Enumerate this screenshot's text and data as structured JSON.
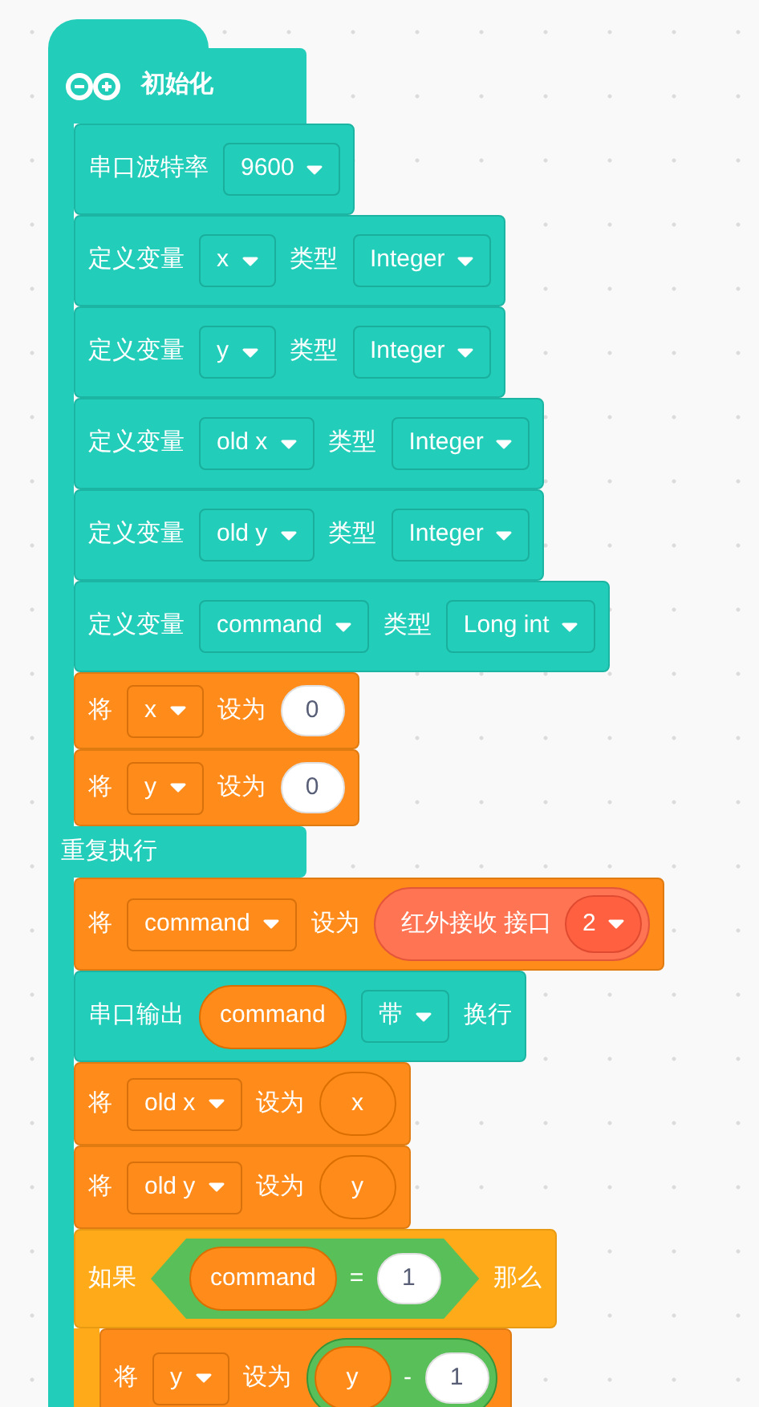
{
  "hat": {
    "label": "初始化"
  },
  "setup": [
    {
      "kind": "arduino",
      "parts": [
        {
          "kind": "text",
          "text": "串口波特率"
        },
        {
          "kind": "dropdown",
          "text": "9600"
        }
      ]
    },
    {
      "kind": "arduino",
      "parts": [
        {
          "kind": "text",
          "text": "定义变量"
        },
        {
          "kind": "dropdown",
          "text": "x"
        },
        {
          "kind": "text",
          "text": "类型"
        },
        {
          "kind": "dropdown",
          "text": "Integer"
        }
      ]
    },
    {
      "kind": "arduino",
      "parts": [
        {
          "kind": "text",
          "text": "定义变量"
        },
        {
          "kind": "dropdown",
          "text": "y"
        },
        {
          "kind": "text",
          "text": "类型"
        },
        {
          "kind": "dropdown",
          "text": "Integer"
        }
      ]
    },
    {
      "kind": "arduino",
      "parts": [
        {
          "kind": "text",
          "text": "定义变量"
        },
        {
          "kind": "dropdown",
          "text": "old x"
        },
        {
          "kind": "text",
          "text": "类型"
        },
        {
          "kind": "dropdown",
          "text": "Integer"
        }
      ]
    },
    {
      "kind": "arduino",
      "parts": [
        {
          "kind": "text",
          "text": "定义变量"
        },
        {
          "kind": "dropdown",
          "text": "old y"
        },
        {
          "kind": "text",
          "text": "类型"
        },
        {
          "kind": "dropdown",
          "text": "Integer"
        }
      ]
    },
    {
      "kind": "arduino",
      "parts": [
        {
          "kind": "text",
          "text": "定义变量"
        },
        {
          "kind": "dropdown",
          "text": "command"
        },
        {
          "kind": "text",
          "text": "类型"
        },
        {
          "kind": "dropdown",
          "text": "Long int"
        }
      ]
    },
    {
      "kind": "variable",
      "parts": [
        {
          "kind": "text",
          "text": "将"
        },
        {
          "kind": "dropdown",
          "text": "x"
        },
        {
          "kind": "text",
          "text": "设为"
        },
        {
          "kind": "number",
          "text": "0"
        }
      ]
    },
    {
      "kind": "variable",
      "parts": [
        {
          "kind": "text",
          "text": "将"
        },
        {
          "kind": "dropdown",
          "text": "y"
        },
        {
          "kind": "text",
          "text": "设为"
        },
        {
          "kind": "number",
          "text": "0"
        }
      ]
    }
  ],
  "loop": {
    "label": "重复执行",
    "blocks": [
      {
        "kind": "variable",
        "parts": [
          {
            "kind": "text",
            "text": "将"
          },
          {
            "kind": "dropdown",
            "text": "command"
          },
          {
            "kind": "text",
            "text": "设为"
          },
          {
            "kind": "sensor",
            "label": "红外接收 接口",
            "dropdown": "2"
          }
        ]
      },
      {
        "kind": "arduino",
        "parts": [
          {
            "kind": "text",
            "text": "串口输出"
          },
          {
            "kind": "variable",
            "text": "command"
          },
          {
            "kind": "dropdown",
            "text": "带"
          },
          {
            "kind": "text",
            "text": "换行"
          }
        ]
      },
      {
        "kind": "variable",
        "parts": [
          {
            "kind": "text",
            "text": "将"
          },
          {
            "kind": "dropdown",
            "text": "old x"
          },
          {
            "kind": "text",
            "text": "设为"
          },
          {
            "kind": "variable",
            "text": "x"
          }
        ]
      },
      {
        "kind": "variable",
        "parts": [
          {
            "kind": "text",
            "text": "将"
          },
          {
            "kind": "dropdown",
            "text": "old y"
          },
          {
            "kind": "text",
            "text": "设为"
          },
          {
            "kind": "variable",
            "text": "y"
          }
        ]
      },
      {
        "kind": "control",
        "parts": [
          {
            "kind": "text",
            "text": "如果"
          },
          {
            "kind": "compare",
            "left": {
              "kind": "variable",
              "text": "command"
            },
            "operator": "=",
            "right": {
              "kind": "number",
              "text": "1"
            }
          },
          {
            "kind": "text",
            "text": "那么"
          }
        ],
        "children": [
          {
            "kind": "variable",
            "parts": [
              {
                "kind": "text",
                "text": "将"
              },
              {
                "kind": "dropdown",
                "text": "y"
              },
              {
                "kind": "text",
                "text": "设为"
              },
              {
                "kind": "operator",
                "left": {
                  "kind": "variable",
                  "text": "y"
                },
                "operator": "-",
                "right": {
                  "kind": "number",
                  "text": "1"
                }
              }
            ]
          }
        ]
      }
    ]
  }
}
